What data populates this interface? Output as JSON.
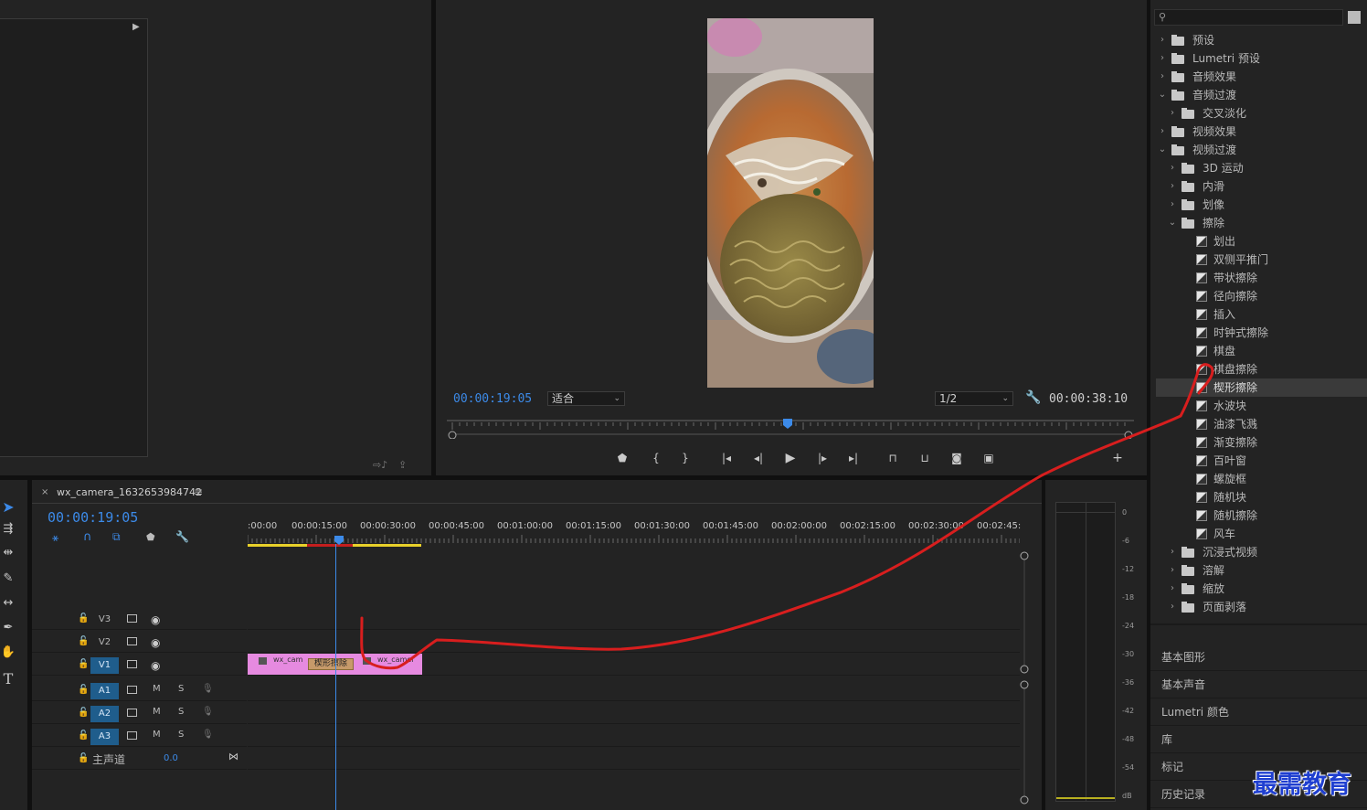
{
  "program": {
    "timecode_current": "00:00:19:05",
    "zoom_value": "适合",
    "resolution_value": "1/2",
    "timecode_duration": "00:00:38:10"
  },
  "effects": {
    "search_placeholder": "",
    "tree": [
      {
        "label": "预设",
        "level": 0,
        "kind": "preset",
        "open": false
      },
      {
        "label": "Lumetri 预设",
        "level": 0,
        "kind": "preset",
        "open": false
      },
      {
        "label": "音频效果",
        "level": 0,
        "kind": "folder",
        "open": false
      },
      {
        "label": "音频过渡",
        "level": 0,
        "kind": "folder",
        "open": true
      },
      {
        "label": "交叉淡化",
        "level": 1,
        "kind": "folder",
        "open": false
      },
      {
        "label": "视频效果",
        "level": 0,
        "kind": "folder",
        "open": false
      },
      {
        "label": "视频过渡",
        "level": 0,
        "kind": "folder",
        "open": true
      },
      {
        "label": "3D 运动",
        "level": 1,
        "kind": "folder",
        "open": false
      },
      {
        "label": "内滑",
        "level": 1,
        "kind": "folder",
        "open": false
      },
      {
        "label": "划像",
        "level": 1,
        "kind": "folder",
        "open": false
      },
      {
        "label": "擦除",
        "level": 1,
        "kind": "folder",
        "open": true
      },
      {
        "label": "划出",
        "level": 2,
        "kind": "transition"
      },
      {
        "label": "双侧平推门",
        "level": 2,
        "kind": "transition"
      },
      {
        "label": "带状擦除",
        "level": 2,
        "kind": "transition"
      },
      {
        "label": "径向擦除",
        "level": 2,
        "kind": "transition"
      },
      {
        "label": "插入",
        "level": 2,
        "kind": "transition"
      },
      {
        "label": "时钟式擦除",
        "level": 2,
        "kind": "transition"
      },
      {
        "label": "棋盘",
        "level": 2,
        "kind": "transition"
      },
      {
        "label": "棋盘擦除",
        "level": 2,
        "kind": "transition"
      },
      {
        "label": "楔形擦除",
        "level": 2,
        "kind": "transition",
        "selected": true
      },
      {
        "label": "水波块",
        "level": 2,
        "kind": "transition"
      },
      {
        "label": "油漆飞溅",
        "level": 2,
        "kind": "transition"
      },
      {
        "label": "渐变擦除",
        "level": 2,
        "kind": "transition"
      },
      {
        "label": "百叶窗",
        "level": 2,
        "kind": "transition"
      },
      {
        "label": "螺旋框",
        "level": 2,
        "kind": "transition"
      },
      {
        "label": "随机块",
        "level": 2,
        "kind": "transition"
      },
      {
        "label": "随机擦除",
        "level": 2,
        "kind": "transition"
      },
      {
        "label": "风车",
        "level": 2,
        "kind": "transition"
      },
      {
        "label": "沉浸式视频",
        "level": 1,
        "kind": "folder",
        "open": false
      },
      {
        "label": "溶解",
        "level": 1,
        "kind": "folder",
        "open": false
      },
      {
        "label": "缩放",
        "level": 1,
        "kind": "folder",
        "open": false
      },
      {
        "label": "页面剥落",
        "level": 1,
        "kind": "folder",
        "open": false
      }
    ],
    "side_panels": [
      "基本图形",
      "基本声音",
      "Lumetri 颜色",
      "库",
      "标记",
      "历史记录"
    ]
  },
  "timeline": {
    "sequence_name": "wx_camera_1632653984742",
    "timecode": "00:00:19:05",
    "ruler_labels": [
      ":00:00",
      "00:00:15:00",
      "00:00:30:00",
      "00:00:45:00",
      "00:01:00:00",
      "00:01:15:00",
      "00:01:30:00",
      "00:01:45:00",
      "00:02:00:00",
      "00:02:15:00",
      "00:02:30:00",
      "00:02:45:"
    ],
    "video_tracks": [
      "V3",
      "V2",
      "V1"
    ],
    "audio_tracks": [
      "A1",
      "A2",
      "A3"
    ],
    "master_label": "主声道",
    "master_value": "0.0",
    "clip1_label": "wx_cam",
    "transition_label": "楔形擦除",
    "clip2_label": "wx_camer",
    "m_label": "M",
    "s_label": "S"
  },
  "meter": {
    "db_labels": [
      "0",
      "-6",
      "-12",
      "-18",
      "-24",
      "-30",
      "-36",
      "-42",
      "-48",
      "-54",
      "dB"
    ]
  },
  "watermark": "最需教育",
  "colors": {
    "accent_blue": "#3c8ae8",
    "clip_pink": "#e68ae0",
    "annotation_red": "#d81e1e",
    "track_blue": "#1f5d8c"
  }
}
